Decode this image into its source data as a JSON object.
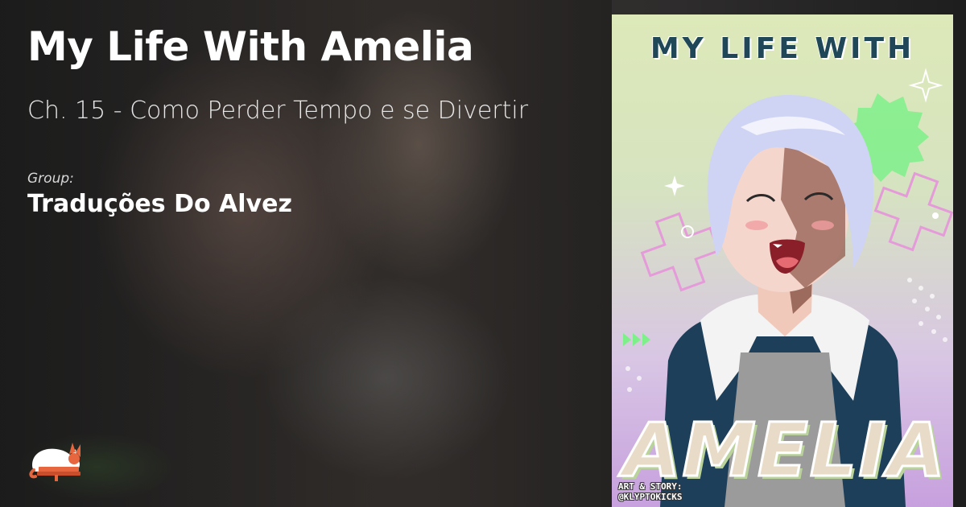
{
  "header": {
    "title": "My Life With Amelia",
    "chapter": "Ch. 15 - Como Perder Tempo e se Divertir",
    "group_label": "Group:",
    "group_name": "Traduções Do Alvez"
  },
  "logo": {
    "icon": "cat-book-logo-icon"
  },
  "cover": {
    "title_top": "MY LIFE WITH",
    "title_big": "AMELIA",
    "credit_line1": "ART & STORY:",
    "credit_line2": "@KLYPTOKICKS"
  },
  "colors": {
    "title_text": "#ffffff",
    "cover_title": "#1f4757",
    "cover_bg_top": "#dde9b8",
    "cover_bg_bottom": "#c7a0de",
    "logo_orange": "#e8663d"
  }
}
